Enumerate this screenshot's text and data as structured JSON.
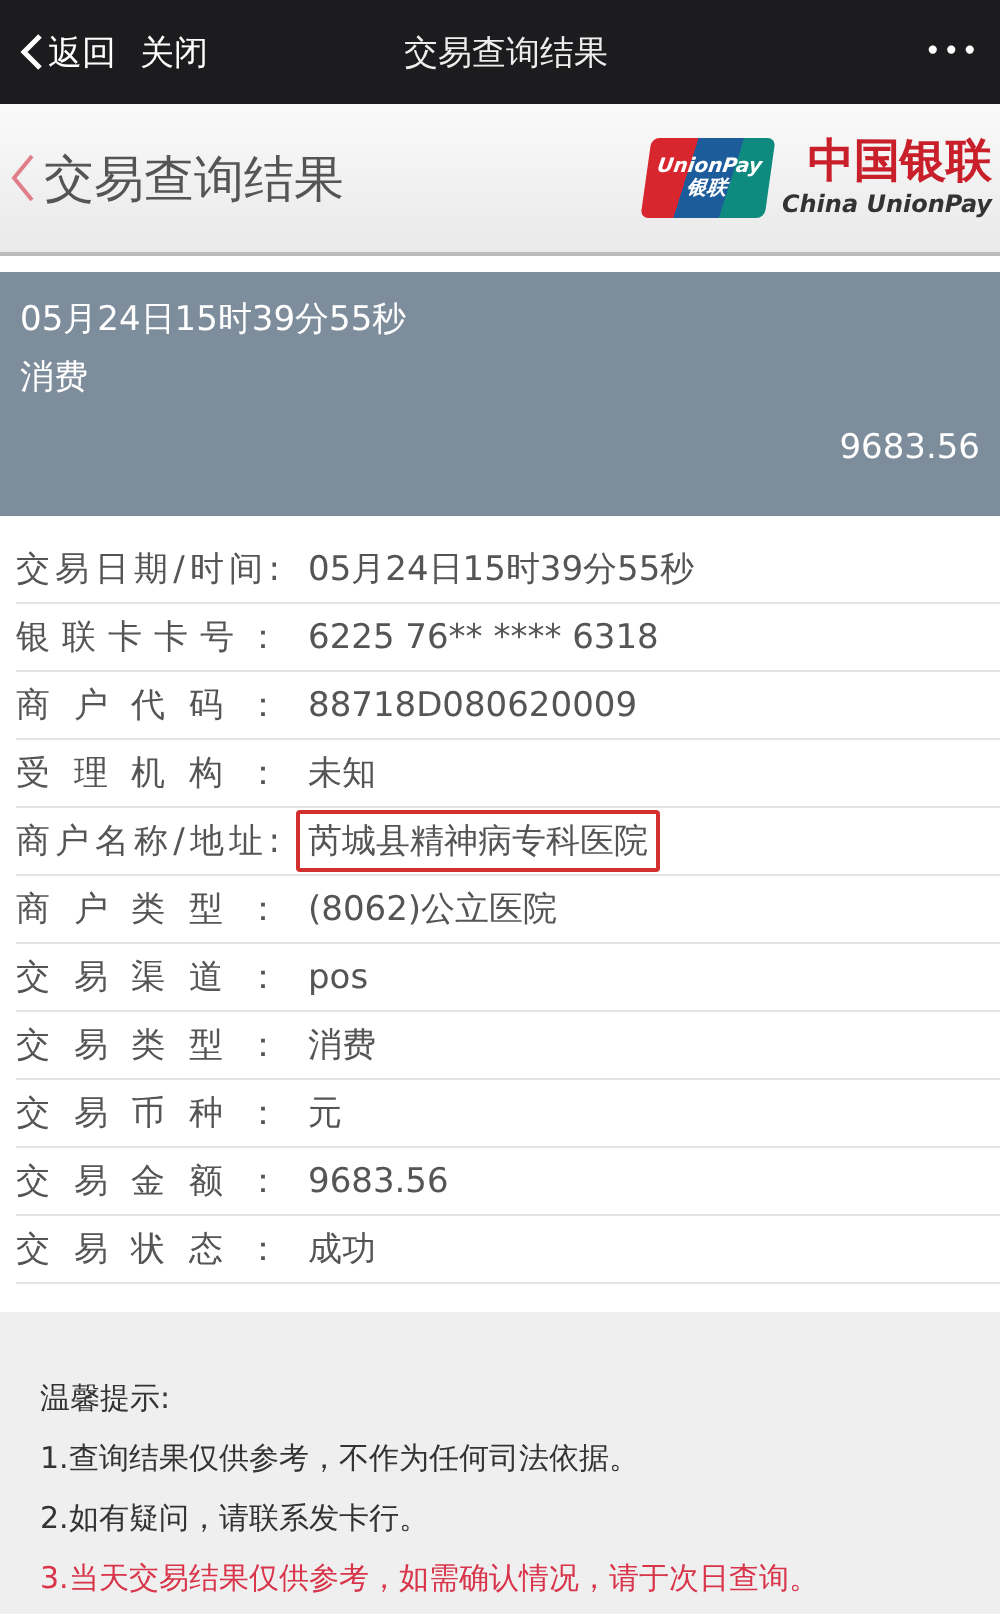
{
  "nav_bar": {
    "back": "返回",
    "close": "关闭",
    "title": "交易查询结果",
    "more": "•••"
  },
  "header": {
    "title": "交易查询结果",
    "logo": {
      "badge_top": "UnionPay",
      "badge_bottom": "银联",
      "name_cn": "中国银联",
      "name_en": "China UnionPay"
    }
  },
  "summary": {
    "time": "05月24日15时39分55秒",
    "type": "消费",
    "amount": "9683.56"
  },
  "details": [
    {
      "label": "交易日期/时间:",
      "value": "05月24日15时39分55秒",
      "highlighted": false
    },
    {
      "label": "银联卡卡号：",
      "value": "6225 76** **** 6318",
      "highlighted": false
    },
    {
      "label": "商户代码：",
      "value": "88718D080620009",
      "highlighted": false
    },
    {
      "label": "受理机构：",
      "value": "未知",
      "highlighted": false
    },
    {
      "label": "商户名称/地址:",
      "value": "芮城县精神病专科医院",
      "highlighted": true
    },
    {
      "label": "商户类型：",
      "value": "(8062)公立医院",
      "highlighted": false
    },
    {
      "label": "交易渠道：",
      "value": "pos",
      "highlighted": false
    },
    {
      "label": "交易类型：",
      "value": "消费",
      "highlighted": false
    },
    {
      "label": "交易币种：",
      "value": "元",
      "highlighted": false
    },
    {
      "label": "交易金额：",
      "value": "9683.56",
      "highlighted": false
    },
    {
      "label": "交易状态：",
      "value": "成功",
      "highlighted": false
    }
  ],
  "notice": {
    "title": "温馨提示:",
    "items": [
      {
        "text": "1.查询结果仅供参考，不作为任何司法依据。",
        "kind": "normal"
      },
      {
        "text": "2.如有疑问，请联系发卡行。",
        "kind": "normal"
      },
      {
        "text": "3.当天交易结果仅供参考，如需确认情况，请于次日查询。",
        "kind": "warning"
      }
    ]
  }
}
